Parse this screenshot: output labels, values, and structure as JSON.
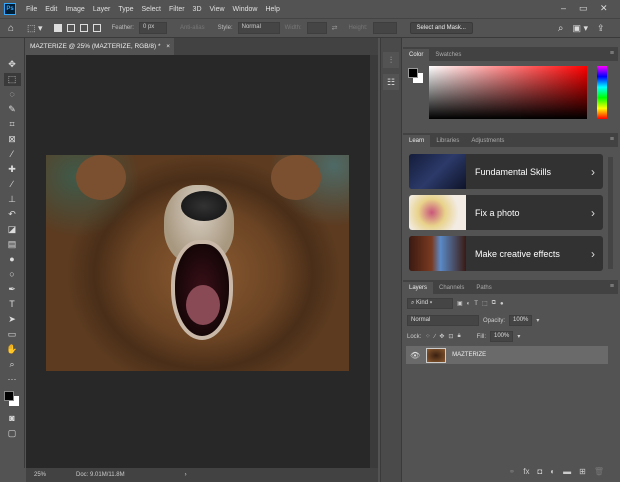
{
  "app": {
    "logo": "Ps",
    "menu": [
      "File",
      "Edit",
      "Image",
      "Layer",
      "Type",
      "Select",
      "Filter",
      "3D",
      "View",
      "Window",
      "Help"
    ],
    "window_controls": [
      "minimize",
      "maximize",
      "close"
    ]
  },
  "options": {
    "feather_label": "Feather:",
    "feather_value": "0 px",
    "antialias_label": "Anti-alias",
    "style_label": "Style:",
    "style_value": "Normal",
    "width_label": "Width:",
    "height_label": "Height:",
    "select_mask": "Select and Mask..."
  },
  "document": {
    "tab_title": "MAZTERIZE @ 25% (MAZTERIZE, RGB/8) *",
    "close": "×",
    "zoom": "25%",
    "doc_size": "Doc: 9.01M/11.8M"
  },
  "color_panel": {
    "tabs": [
      "Color",
      "Swatches"
    ],
    "foreground": "#000000",
    "background": "#ffffff",
    "hue": "#ff0000"
  },
  "learn_panel": {
    "tabs": [
      "Learn",
      "Libraries",
      "Adjustments"
    ],
    "cards": [
      {
        "label": "Fundamental Skills"
      },
      {
        "label": "Fix a photo"
      },
      {
        "label": "Make creative effects"
      }
    ]
  },
  "layers_panel": {
    "tabs": [
      "Layers",
      "Channels",
      "Paths"
    ],
    "kind": "Kind",
    "blend_mode": "Normal",
    "opacity_label": "Opacity:",
    "opacity": "100%",
    "lock_label": "Lock:",
    "fill_label": "Fill:",
    "fill": "100%",
    "layers": [
      {
        "name": "MAZTERIZE",
        "visible": true
      }
    ]
  }
}
